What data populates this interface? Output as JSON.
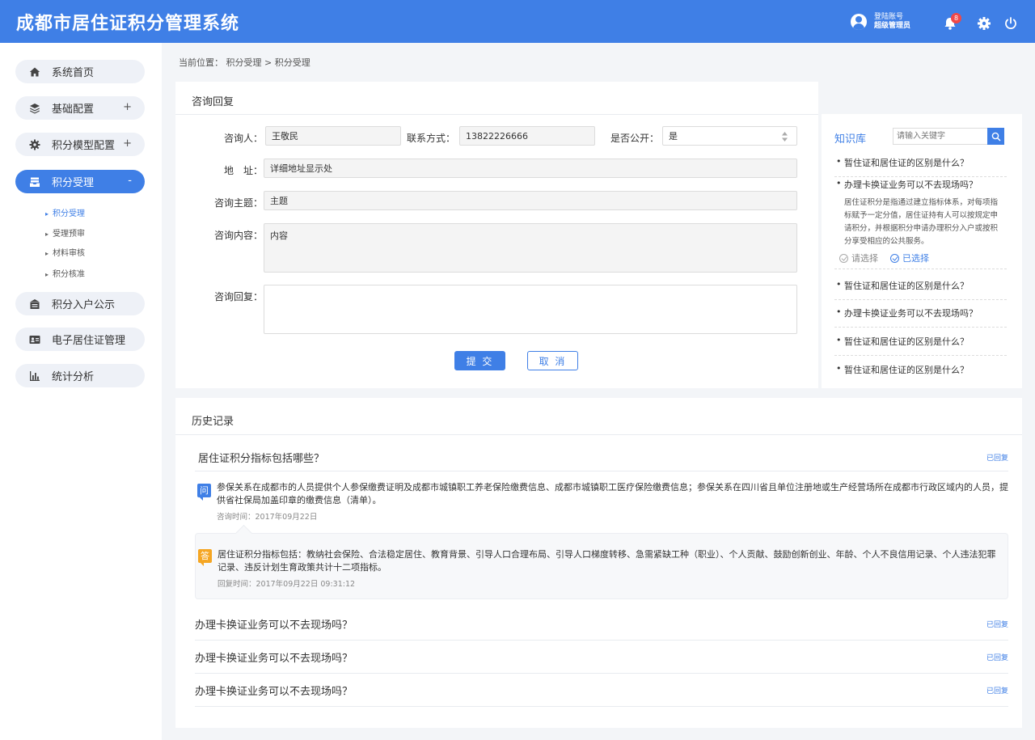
{
  "header": {
    "title": "成都市居住证积分管理系统",
    "account_label": "登陆账号",
    "account_role": "超级管理员",
    "notifications": "8"
  },
  "sidebar": {
    "items": [
      {
        "label": "系统首页",
        "icon": "home-icon"
      },
      {
        "label": "基础配置",
        "icon": "layers-icon",
        "toggle": "+"
      },
      {
        "label": "积分模型配置",
        "icon": "gear-icon",
        "toggle": "+"
      },
      {
        "label": "积分受理",
        "icon": "inbox-icon",
        "toggle": "-"
      },
      {
        "label": "积分入户公示",
        "icon": "announce-icon"
      },
      {
        "label": "电子居住证管理",
        "icon": "id-card-icon"
      },
      {
        "label": "统计分析",
        "icon": "bar-chart-icon"
      }
    ],
    "sub_items": [
      "积分受理",
      "受理预审",
      "材料审核",
      "积分核准"
    ]
  },
  "breadcrumb": "当前位置： 积分受理 > 积分受理",
  "consult": {
    "title": "咨询回复",
    "asker_label": "咨询人：",
    "asker_value": "王敬民",
    "contact_label": "联系方式：",
    "contact_value": "13822226666",
    "public_label": "是否公开：",
    "public_value": "是",
    "address_label": "地　址：",
    "address_value": "详细地址显示处",
    "subject_label": "咨询主题：",
    "subject_value": "主题",
    "content_label": "咨询内容：",
    "content_value": "内容",
    "reply_label": "咨询回复：",
    "submit": "提 交",
    "cancel": "取 消"
  },
  "kb": {
    "title": "知识库",
    "search_placeholder": "请输入关键字",
    "questions": [
      "暂住证和居住证的区别是什么？",
      "办理卡换证业务可以不去现场吗？",
      "暂住证和居住证的区别是什么？",
      "办理卡换证业务可以不去现场吗？",
      "暂住证和居住证的区别是什么？",
      "暂住证和居住证的区别是什么？"
    ],
    "answer": "居住证积分是指通过建立指标体系，对每项指标赋予一定分值，居住证持有人可以按规定申请积分，并根据积分申请办理积分入户或按积分享受相应的公共服务。",
    "opt_unselected": "请选择",
    "opt_selected": "已选择"
  },
  "history": {
    "title": "历史记录",
    "items": [
      {
        "question": "居住证积分指标包括哪些？",
        "status": "已回复"
      },
      {
        "question": "办理卡换证业务可以不去现场吗？",
        "status": "已回复"
      },
      {
        "question": "办理卡换证业务可以不去现场吗？",
        "status": "已回复"
      },
      {
        "question": "办理卡换证业务可以不去现场吗？",
        "status": "已回复"
      }
    ],
    "q_icon": "问",
    "a_icon": "答",
    "q_text": "参保关系在成都市的人员提供个人参保缴费证明及成都市城镇职工养老保险缴费信息、成都市城镇职工医疗保险缴费信息；参保关系在四川省且单位注册地或生产经营场所在成都市行政区域内的人员，提供省社保局加盖印章的缴费信息（清单）。",
    "q_time": "咨询时间：2017年09月22日",
    "a_text": "居住证积分指标包括：教纳社会保险、合法稳定居住、教育背景、引导人口合理布局、引导人口梯度转移、急需紧缺工种（职业）、个人贡献、鼓励创新创业、年龄、个人不良信用记录、个人违法犯罪记录、违反计划生育政策共计十二项指标。",
    "a_time": "回复时间：2017年09月22日 09:31:12"
  },
  "colors": {
    "primary": "#3f7fe6",
    "badge": "#f04848",
    "answer_icon": "#f5a623"
  }
}
